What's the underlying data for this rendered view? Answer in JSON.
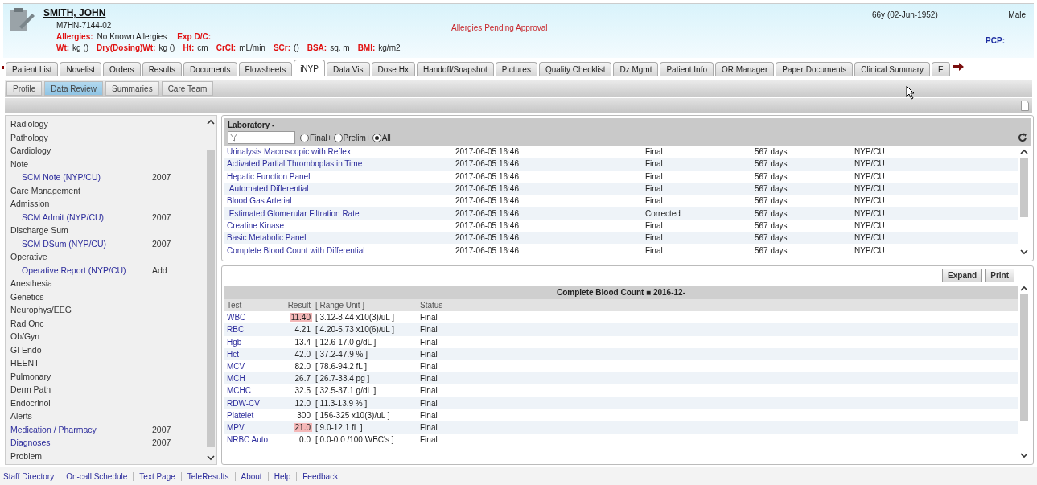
{
  "patient": {
    "name": "SMITH, JOHN",
    "mrn": "M7HN-7144-02",
    "alert": "Allergies Pending Approval",
    "age_dob": "66y (02-Jun-1952)",
    "sex": "Male",
    "allergies_label": "Allergies:",
    "allergies_value": "No Known Allergies",
    "exp_label": "Exp D/C:",
    "pcp_label": "PCP:",
    "measurements": [
      {
        "label": "Wt:",
        "text": "kg ()"
      },
      {
        "label": "Dry(Dosing)Wt:",
        "text": "kg ()"
      },
      {
        "label": "Ht:",
        "text": "cm"
      },
      {
        "label": "CrCl:",
        "text": "mL/min"
      },
      {
        "label": "SCr:",
        "text": "()"
      },
      {
        "label": "BSA:",
        "text": "sq. m"
      },
      {
        "label": "BMI:",
        "text": "kg/m2"
      }
    ]
  },
  "tabs": [
    {
      "label": "Patient List",
      "selected": false
    },
    {
      "label": "Novelist",
      "selected": false
    },
    {
      "label": "Orders",
      "selected": false
    },
    {
      "label": "Results",
      "selected": false
    },
    {
      "label": "Documents",
      "selected": false
    },
    {
      "label": "Flowsheets",
      "selected": false
    },
    {
      "label": "iNYP",
      "selected": true
    },
    {
      "label": "Data Vis",
      "selected": false
    },
    {
      "label": "Dose Hx",
      "selected": false
    },
    {
      "label": "Handoff/Snapshot",
      "selected": false
    },
    {
      "label": "Pictures",
      "selected": false
    },
    {
      "label": "Quality Checklist",
      "selected": false
    },
    {
      "label": "Dz Mgmt",
      "selected": false
    },
    {
      "label": "Patient Info",
      "selected": false
    },
    {
      "label": "OR Manager",
      "selected": false
    },
    {
      "label": "Paper Documents",
      "selected": false
    },
    {
      "label": "Clinical Summary",
      "selected": false
    },
    {
      "label": "E",
      "selected": false
    }
  ],
  "subtabs": [
    {
      "label": "Profile",
      "selected": false
    },
    {
      "label": "Data Review",
      "selected": true
    },
    {
      "label": "Summaries",
      "selected": false
    },
    {
      "label": "Care Team",
      "selected": false
    }
  ],
  "sidebar": {
    "items": [
      {
        "label": "Radiology",
        "kind": "heading"
      },
      {
        "label": "Pathology",
        "kind": "heading"
      },
      {
        "label": "Cardiology",
        "kind": "heading"
      },
      {
        "label": "Note",
        "kind": "heading",
        "children": [
          {
            "label": "SCM Note (NYP/CU)",
            "value": "2007"
          }
        ]
      },
      {
        "label": "Care Management",
        "kind": "heading"
      },
      {
        "label": "Admission",
        "kind": "heading",
        "children": [
          {
            "label": "SCM Admit (NYP/CU)",
            "value": "2007"
          }
        ]
      },
      {
        "label": "Discharge Sum",
        "kind": "heading",
        "children": [
          {
            "label": "SCM DSum (NYP/CU)",
            "value": "2007"
          }
        ]
      },
      {
        "label": "Operative",
        "kind": "heading",
        "children": [
          {
            "label": "Operative Report (NYP/CU)",
            "value": "Add"
          }
        ]
      },
      {
        "label": "Anesthesia",
        "kind": "heading"
      },
      {
        "label": "Genetics",
        "kind": "heading"
      },
      {
        "label": "Neurophys/EEG",
        "kind": "heading"
      },
      {
        "label": "Rad Onc",
        "kind": "heading"
      },
      {
        "label": "Ob/Gyn",
        "kind": "heading"
      },
      {
        "label": "GI Endo",
        "kind": "heading"
      },
      {
        "label": "HEENT",
        "kind": "heading"
      },
      {
        "label": "Pulmonary",
        "kind": "heading"
      },
      {
        "label": "Derm Path",
        "kind": "heading"
      },
      {
        "label": "Endocrinol",
        "kind": "heading"
      },
      {
        "label": "Alerts",
        "kind": "heading"
      },
      {
        "label": "Medication / Pharmacy",
        "kind": "link",
        "value": "2007"
      },
      {
        "label": "Diagnoses",
        "kind": "link",
        "value": "2007"
      },
      {
        "label": "Problem",
        "kind": "heading"
      }
    ]
  },
  "laboratory": {
    "title": "Laboratory -",
    "filters": [
      {
        "label": "Final+",
        "selected": false
      },
      {
        "label": "Prelim+",
        "selected": false
      },
      {
        "label": "All",
        "selected": true
      }
    ],
    "rows": [
      {
        "cells": [
          "Urinalysis Macroscopic with Reflex",
          "2017-06-05 16:46",
          "Final",
          "567 days",
          "NYP/CU"
        ]
      },
      {
        "cells": [
          "Activated Partial Thromboplastin Time",
          "2017-06-05 16:46",
          "Final",
          "567 days",
          "NYP/CU"
        ]
      },
      {
        "cells": [
          "Hepatic Function Panel",
          "2017-06-05 16:46",
          "Final",
          "567 days",
          "NYP/CU"
        ]
      },
      {
        "cells": [
          ".Automated Differential",
          "2017-06-05 16:46",
          "Final",
          "567 days",
          "NYP/CU"
        ]
      },
      {
        "cells": [
          "Blood Gas Arterial",
          "2017-06-05 16:46",
          "Final",
          "567 days",
          "NYP/CU"
        ]
      },
      {
        "cells": [
          ".Estimated Glomerular Filtration Rate",
          "2017-06-05 16:46",
          "Corrected",
          "567 days",
          "NYP/CU"
        ]
      },
      {
        "cells": [
          "Creatine Kinase",
          "2017-06-05 16:46",
          "Final",
          "567 days",
          "NYP/CU"
        ]
      },
      {
        "cells": [
          "Basic Metabolic Panel",
          "2017-06-05 16:46",
          "Final",
          "567 days",
          "NYP/CU"
        ]
      },
      {
        "cells": [
          "Complete Blood Count with Differential",
          "2017-06-05 16:46",
          "Final",
          "567 days",
          "NYP/CU"
        ]
      }
    ]
  },
  "result": {
    "buttons": [
      "Expand",
      "Print"
    ],
    "title": "Complete Blood Count ■ 2016-12-",
    "columns": [
      "Test",
      "Result",
      "[ Range Unit ]",
      "Status"
    ],
    "rows": [
      {
        "test": "WBC",
        "result": "11.40",
        "range": "[ 3.12-8.44 x10(3)/uL ]",
        "status": "Final",
        "abnormal": true
      },
      {
        "test": "RBC",
        "result": "4.21",
        "range": "[ 4.20-5.73 x10(6)/uL ]",
        "status": "Final",
        "abnormal": false
      },
      {
        "test": "Hgb",
        "result": "13.4",
        "range": "[ 12.6-17.0 g/dL ]",
        "status": "Final",
        "abnormal": false
      },
      {
        "test": "Hct",
        "result": "42.0",
        "range": "[ 37.2-47.9 % ]",
        "status": "Final",
        "abnormal": false
      },
      {
        "test": "MCV",
        "result": "82.0",
        "range": "[ 78.6-94.2 fL ]",
        "status": "Final",
        "abnormal": false
      },
      {
        "test": "MCH",
        "result": "26.7",
        "range": "[ 26.7-33.4 pg ]",
        "status": "Final",
        "abnormal": false
      },
      {
        "test": "MCHC",
        "result": "32.5",
        "range": "[ 32.5-37.1 g/dL ]",
        "status": "Final",
        "abnormal": false
      },
      {
        "test": "RDW-CV",
        "result": "12.0",
        "range": "[ 11.3-13.9 % ]",
        "status": "Final",
        "abnormal": false
      },
      {
        "test": "Platelet",
        "result": "300",
        "range": "[ 156-325 x10(3)/uL ]",
        "status": "Final",
        "abnormal": false
      },
      {
        "test": "MPV",
        "result": "21.0",
        "range": "[ 9.0-12.1 fL ]",
        "status": "Final",
        "abnormal": true
      },
      {
        "test": "NRBC Auto",
        "result": "0.0",
        "range": "[ 0.0-0.0 /100 WBC's ]",
        "status": "Final",
        "abnormal": false
      }
    ]
  },
  "footer": [
    "Staff Directory",
    "On-call Schedule",
    "Text Page",
    "TeleResults",
    "About",
    "Help",
    "Feedback"
  ]
}
